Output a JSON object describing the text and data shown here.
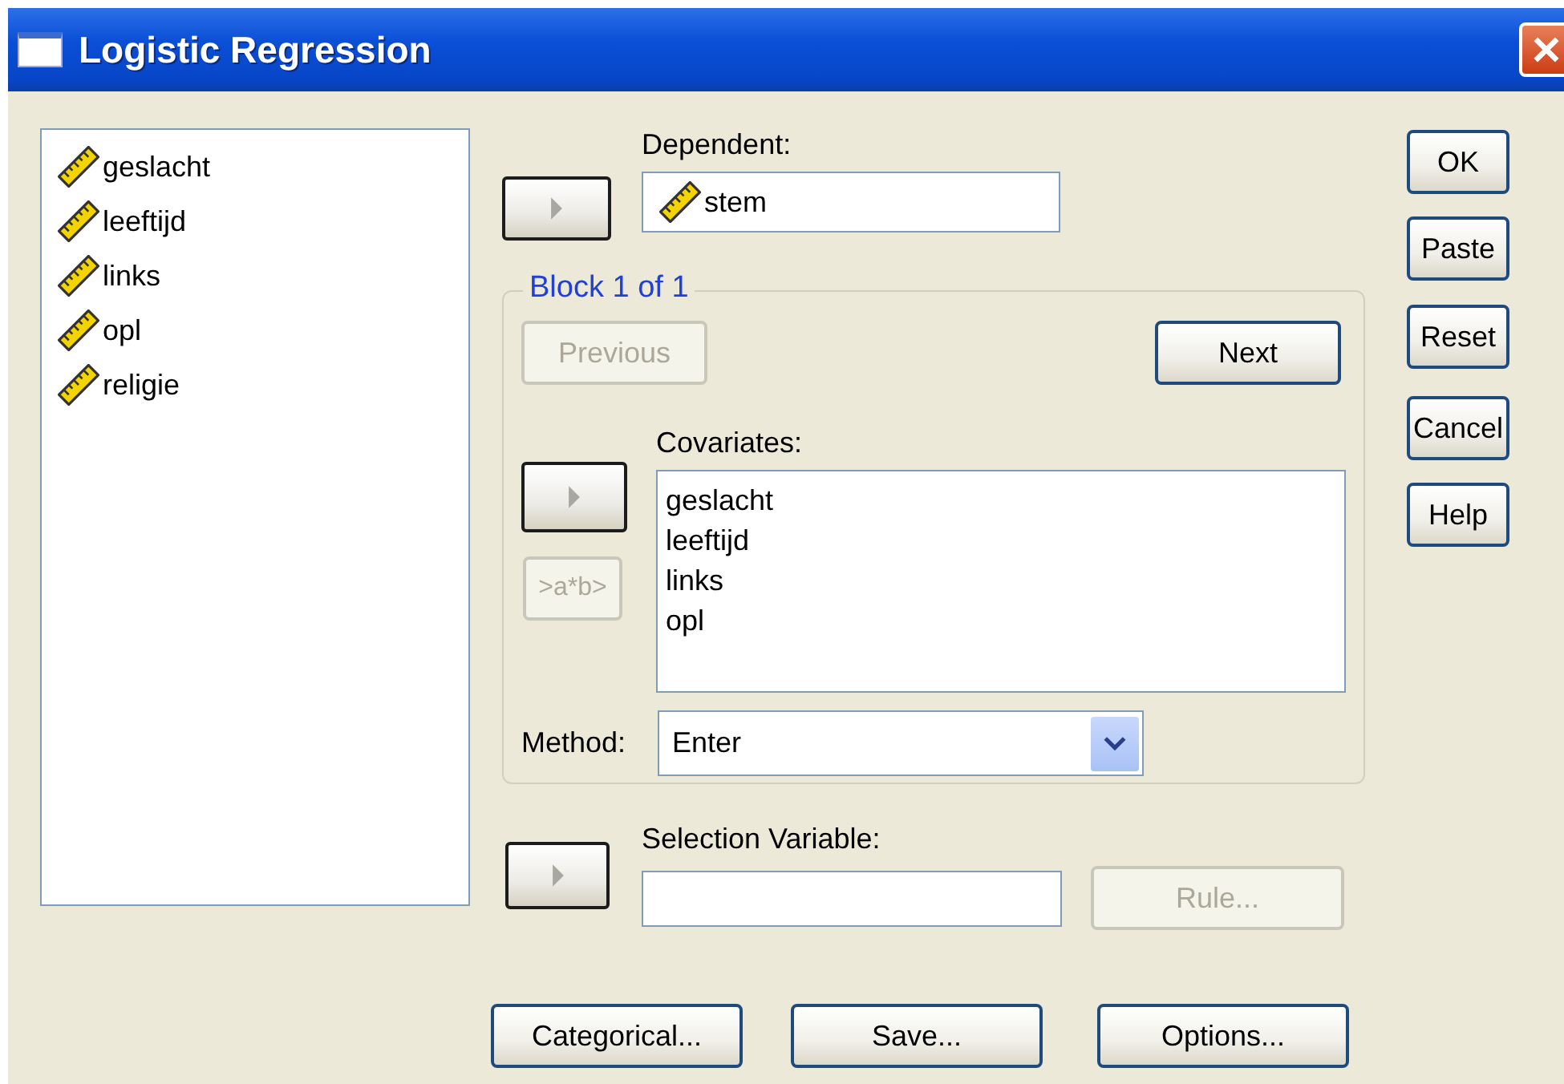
{
  "window": {
    "title": "Logistic Regression"
  },
  "variables": [
    "geslacht",
    "leeftijd",
    "links",
    "opl",
    "religie"
  ],
  "dependent": {
    "label": "Dependent:",
    "value": "stem"
  },
  "block": {
    "legend": "Block 1 of 1",
    "previous": {
      "label": "Previous",
      "disabled": true
    },
    "next": {
      "label": "Next",
      "disabled": false
    },
    "covariates_label": "Covariates:",
    "covariates": [
      "geslacht",
      "leeftijd",
      "links",
      "opl"
    ],
    "interaction_button": {
      "label": ">a*b>",
      "disabled": true
    },
    "method_label": "Method:",
    "method": "Enter"
  },
  "selection": {
    "label": "Selection Variable:",
    "rule_button": {
      "label": "Rule...",
      "disabled": true
    }
  },
  "bottom_buttons": [
    "Categorical...",
    "Save...",
    "Options..."
  ],
  "side_buttons": [
    "OK",
    "Paste",
    "Reset",
    "Cancel",
    "Help"
  ]
}
